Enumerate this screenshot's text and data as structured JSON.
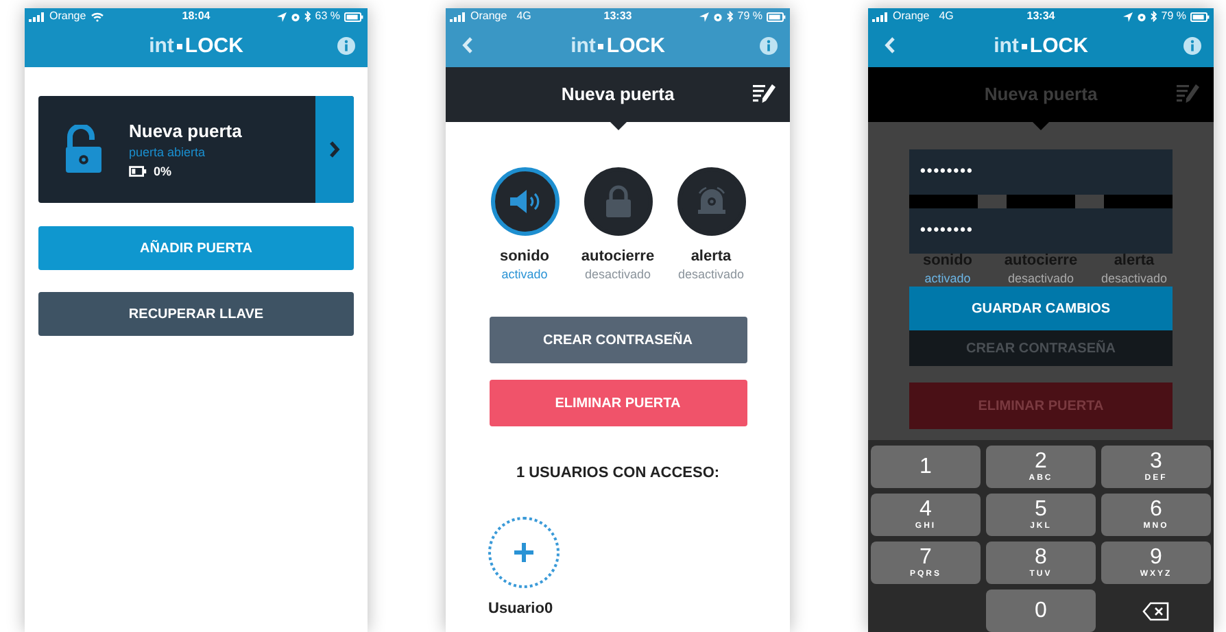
{
  "screens": [
    {
      "kind": "door_list",
      "status_bar": {
        "carrier": "Orange",
        "wifi": true,
        "time": "18:04",
        "battery": "63 %"
      },
      "header": {
        "logo_prefix": "int",
        "logo_suffix": "LOCK",
        "back": false
      },
      "door": {
        "name": "Nueva puerta",
        "status": "puerta abierta",
        "locked": false,
        "battery": "0%"
      },
      "buttons": [
        {
          "label": "AÑADIR PUERTA",
          "kind": "primary"
        },
        {
          "label": "RECUPERAR LLAVE",
          "kind": "secondary"
        }
      ]
    },
    {
      "kind": "door_detail",
      "status_bar": {
        "carrier": "Orange",
        "network": "4G",
        "wifi": false,
        "time": "13:33",
        "battery": "79 %"
      },
      "header": {
        "logo_prefix": "int",
        "logo_suffix": "LOCK",
        "back": true
      },
      "title": "Nueva puerta",
      "settings": [
        {
          "kind": "sound",
          "label": "sonido",
          "status": "activado",
          "on": true
        },
        {
          "kind": "autolock",
          "label": "autocierre",
          "status": "desactivado",
          "on": false
        },
        {
          "kind": "alert",
          "label": "alerta",
          "status": "desactivado",
          "on": false
        }
      ],
      "buttons": [
        {
          "label": "CREAR CONTRASEÑA",
          "kind": "secondary"
        },
        {
          "label": "ELIMINAR PUERTA",
          "kind": "danger"
        }
      ],
      "users_heading": "1 USUARIOS CON ACCESO:",
      "add_user": {
        "label": "Usuario0"
      }
    },
    {
      "kind": "password_edit",
      "status_bar": {
        "carrier": "Orange",
        "network": "4G",
        "wifi": false,
        "time": "13:34",
        "battery": "79 %"
      },
      "header": {
        "logo_prefix": "int",
        "logo_suffix": "LOCK",
        "back": true
      },
      "title": "Nueva puerta",
      "password_fields": [
        {
          "value": "••••••••"
        },
        {
          "value": "••••••••"
        }
      ],
      "settings": [
        {
          "label": "sonido",
          "status": "activado",
          "on": true
        },
        {
          "label": "autocierre",
          "status": "desactivado",
          "on": false
        },
        {
          "label": "alerta",
          "status": "desactivado",
          "on": false
        }
      ],
      "save_button": "GUARDAR CAMBIOS",
      "buttons": [
        {
          "label": "CREAR CONTRASEÑA",
          "kind": "secondary"
        },
        {
          "label": "ELIMINAR PUERTA",
          "kind": "danger"
        }
      ],
      "keypad": [
        {
          "kind": "digit",
          "digit": "1"
        },
        {
          "kind": "digit",
          "digit": "2",
          "letters": "ABC"
        },
        {
          "kind": "digit",
          "digit": "3",
          "letters": "DEF"
        },
        {
          "kind": "digit",
          "digit": "4",
          "letters": "GHI"
        },
        {
          "kind": "digit",
          "digit": "5",
          "letters": "JKL"
        },
        {
          "kind": "digit",
          "digit": "6",
          "letters": "MNO"
        },
        {
          "kind": "digit",
          "digit": "7",
          "letters": "PQRS"
        },
        {
          "kind": "digit",
          "digit": "8",
          "letters": "TUV"
        },
        {
          "kind": "digit",
          "digit": "9",
          "letters": "WXYZ"
        },
        {
          "kind": "blank"
        },
        {
          "kind": "digit",
          "digit": "0"
        },
        {
          "kind": "delete"
        }
      ]
    }
  ]
}
